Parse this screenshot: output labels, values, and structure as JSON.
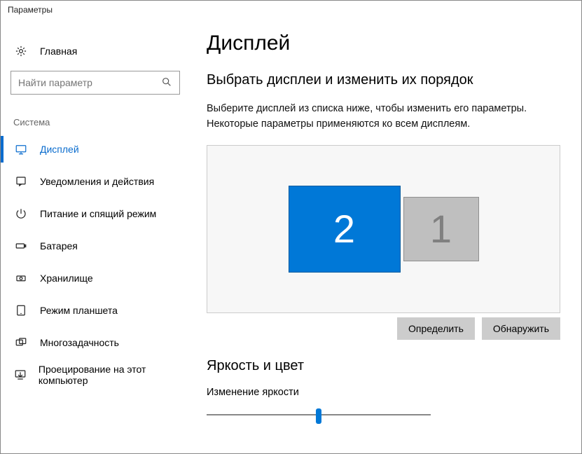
{
  "window": {
    "title": "Параметры"
  },
  "sidebar": {
    "home_label": "Главная",
    "search_placeholder": "Найти параметр",
    "section_label": "Система",
    "items": [
      {
        "label": "Дисплей",
        "icon": "display"
      },
      {
        "label": "Уведомления и действия",
        "icon": "notifications"
      },
      {
        "label": "Питание и спящий режим",
        "icon": "power"
      },
      {
        "label": "Батарея",
        "icon": "battery"
      },
      {
        "label": "Хранилище",
        "icon": "storage"
      },
      {
        "label": "Режим планшета",
        "icon": "tablet"
      },
      {
        "label": "Многозадачность",
        "icon": "multitask"
      },
      {
        "label": "Проецирование на этот компьютер",
        "icon": "project"
      }
    ],
    "active_index": 0
  },
  "main": {
    "title": "Дисплей",
    "arrange_heading": "Выбрать дисплеи и изменить их порядок",
    "arrange_desc": "Выберите дисплей из списка ниже, чтобы изменить его параметры. Некоторые параметры применяются ко всем дисплеям.",
    "monitors": [
      {
        "id": "2",
        "primary": true
      },
      {
        "id": "1",
        "primary": false
      }
    ],
    "identify_label": "Определить",
    "detect_label": "Обнаружить",
    "brightness_heading": "Яркость и цвет",
    "brightness_label": "Изменение яркости",
    "brightness_value": 50
  }
}
